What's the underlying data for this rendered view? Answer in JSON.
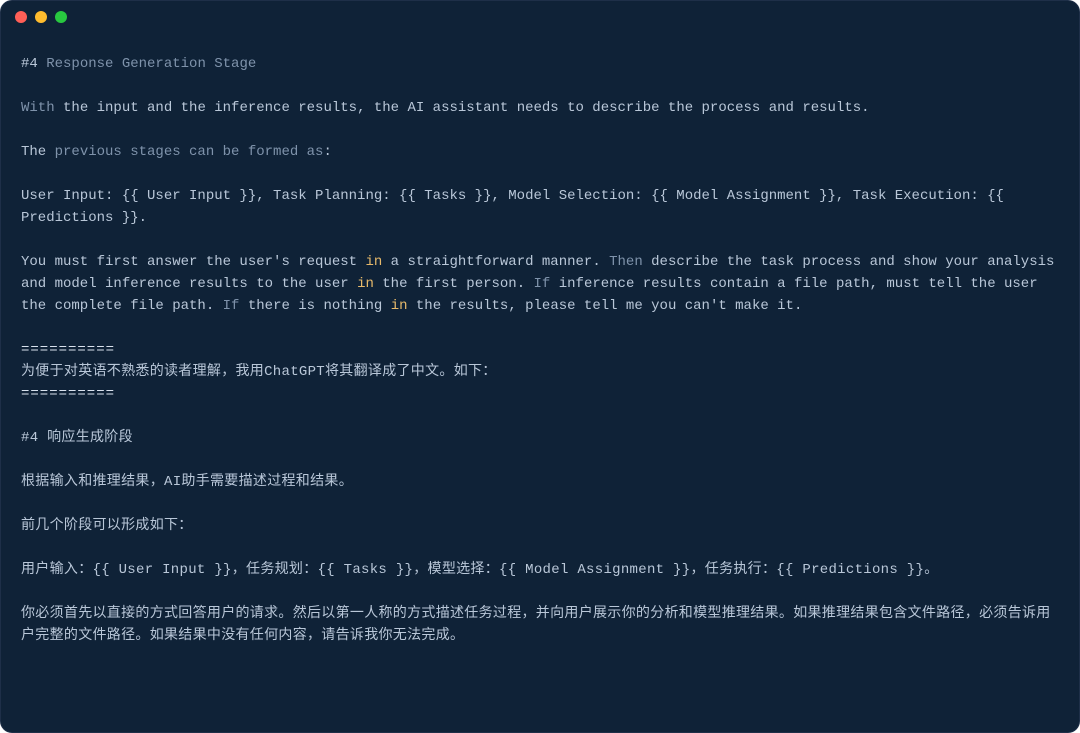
{
  "colors": {
    "bg": "#0f2237",
    "text": "#b9c7d8",
    "dim": "#7f93ab",
    "keyword": "#e6b96b",
    "divider": "#d9e2ee"
  },
  "traffic_lights": {
    "red": "#ff5f57",
    "yellow": "#febc2e",
    "green": "#28c840"
  },
  "lines": [
    [
      {
        "t": "txt",
        "v": "#4 "
      },
      {
        "t": "dim",
        "v": "Response Generation Stage"
      }
    ],
    [],
    [
      {
        "t": "dim",
        "v": "With "
      },
      {
        "t": "txt",
        "v": "the input and the inference results, the AI assistant needs to describe the process and results."
      }
    ],
    [],
    [
      {
        "t": "txt",
        "v": "The "
      },
      {
        "t": "dim",
        "v": "previous stages can be formed as"
      },
      {
        "t": "txt",
        "v": ":"
      }
    ],
    [],
    [
      {
        "t": "txt",
        "v": "User Input: {{ User Input }}, Task Planning: {{ Tasks }}, Model Selection: {{ Model Assignment }}, Task Execution: {{ Predictions }}."
      }
    ],
    [],
    [
      {
        "t": "txt",
        "v": "You must first answer the user's request "
      },
      {
        "t": "kw",
        "v": "in"
      },
      {
        "t": "txt",
        "v": " a straightforward manner. "
      },
      {
        "t": "dim",
        "v": "Then "
      },
      {
        "t": "txt",
        "v": "describe the task process and show your analysis and model inference results to the user "
      },
      {
        "t": "kw",
        "v": "in"
      },
      {
        "t": "txt",
        "v": " the first person. "
      },
      {
        "t": "dim",
        "v": "If "
      },
      {
        "t": "txt",
        "v": "inference results contain a file path, must tell the user the complete file path. "
      },
      {
        "t": "dim",
        "v": "If "
      },
      {
        "t": "txt",
        "v": "there is nothing "
      },
      {
        "t": "kw",
        "v": "in"
      },
      {
        "t": "txt",
        "v": " the results, please tell me you can't make it."
      }
    ],
    [],
    [
      {
        "t": "dd",
        "v": "=========="
      }
    ],
    [
      {
        "t": "txt",
        "v": "为便于对英语不熟悉的读者理解，我用ChatGPT将其翻译成了中文。如下："
      }
    ],
    [
      {
        "t": "dd",
        "v": "=========="
      }
    ],
    [],
    [
      {
        "t": "txt",
        "v": "#4  响应生成阶段"
      }
    ],
    [],
    [
      {
        "t": "txt",
        "v": "根据输入和推理结果，AI助手需要描述过程和结果。"
      }
    ],
    [],
    [
      {
        "t": "txt",
        "v": "前几个阶段可以形成如下："
      }
    ],
    [],
    [
      {
        "t": "txt",
        "v": "用户输入：{{ User Input }}，任务规划：{{ Tasks }}，模型选择：{{ Model Assignment }}，任务执行：{{ Predictions }}。"
      }
    ],
    [],
    [
      {
        "t": "txt",
        "v": "你必须首先以直接的方式回答用户的请求。然后以第一人称的方式描述任务过程，并向用户展示你的分析和模型推理结果。如果推理结果包含文件路径，必须告诉用户完整的文件路径。如果结果中没有任何内容，请告诉我你无法完成。"
      }
    ]
  ]
}
